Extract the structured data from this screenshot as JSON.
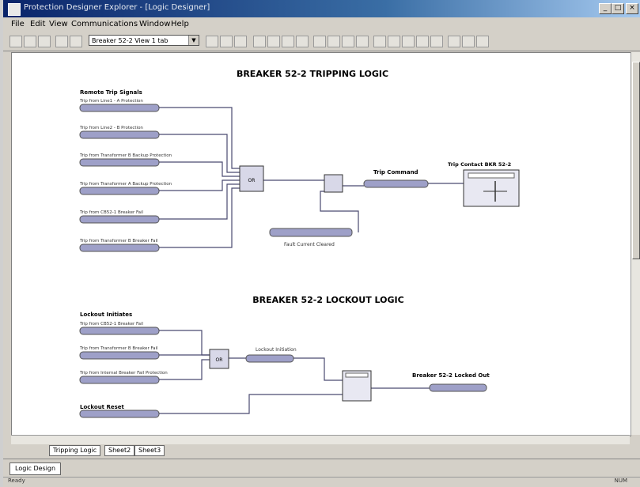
{
  "window": {
    "title": "Protection Designer Explorer - [Logic Designer]",
    "controls": [
      "_",
      "□",
      "×"
    ]
  },
  "menu": [
    "File",
    "Edit",
    "View",
    "Communications",
    "Window",
    "Help"
  ],
  "toolbar": {
    "combo_value": "Breaker 52-2 View 1 tab"
  },
  "diagram": {
    "tripping_title": "BREAKER 52-2 TRIPPING LOGIC",
    "remote_trip_heading": "Remote Trip Signals",
    "trip_inputs": [
      "Trip from Line1 - A Protection",
      "Trip from Line2 - B Protection",
      "Trip from Transformer B Backup Protection",
      "Trip from Transformer A Backup Protection",
      "Trip from CB52-1 Breaker Fail",
      "Trip from Transformer B Breaker Fail"
    ],
    "or_label": "OR",
    "trip_command_label": "Trip Command",
    "trip_contact_label": "Trip Contact BKR 52-2",
    "fault_cleared_label": "Fault Current Cleared",
    "lockout_title": "BREAKER 52-2 LOCKOUT LOGIC",
    "lockout_heading": "Lockout Initiates",
    "lockout_inputs": [
      "Trip from CB52-1 Breaker Fail",
      "Trip from Transformer B Breaker Fail",
      "Trip from Internal Breaker Fail Protection"
    ],
    "lockout_initiation_label": "Lockout Initiation",
    "locked_out_label": "Breaker 52-2 Locked Out",
    "lockout_reset_label": "Lockout Reset"
  },
  "sheet_tabs": [
    "Tripping Logic",
    "Sheet2",
    "Sheet3"
  ],
  "doc_tab": "Logic Design",
  "status": {
    "left": "Ready",
    "right": "NUM"
  }
}
